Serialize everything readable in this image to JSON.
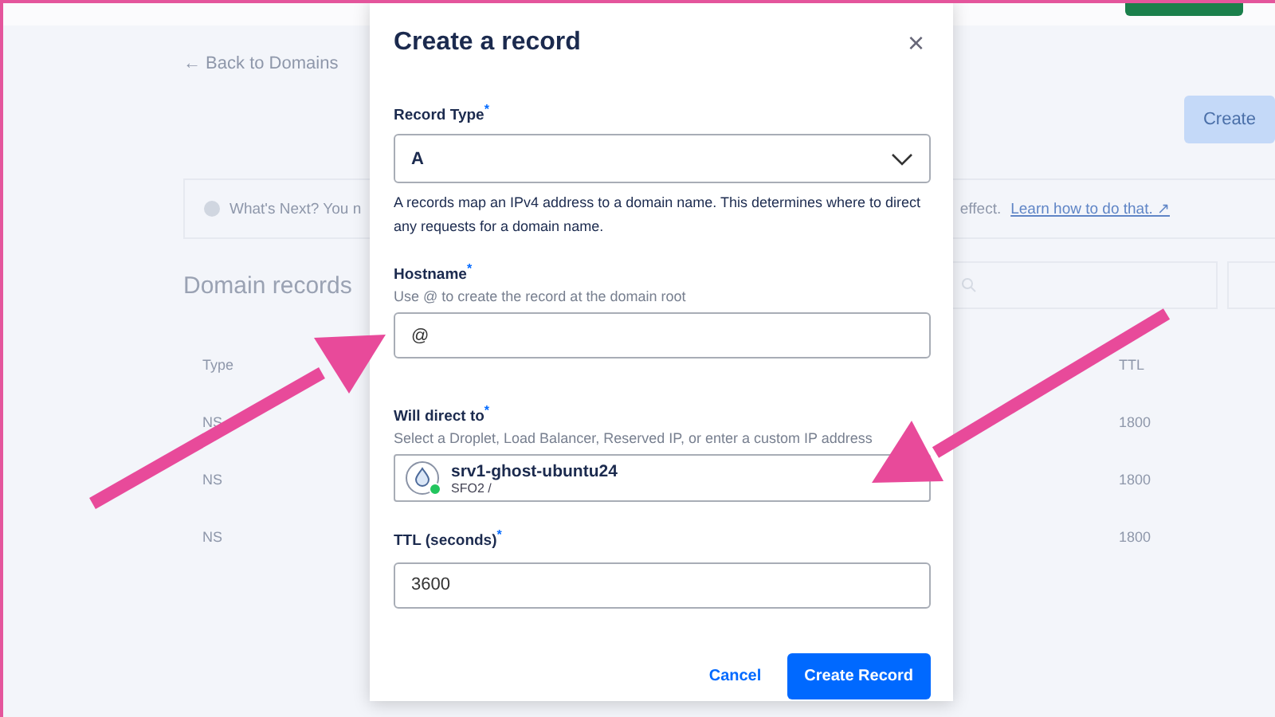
{
  "page": {
    "back_link": "← Back to Domains",
    "create_button": "Create",
    "info": {
      "text": "What's Next? You n",
      "tail": "effect.",
      "link": "Learn how to do that. ↗"
    },
    "section_title": "Domain records",
    "table": {
      "columns": [
        "Type",
        "TTL"
      ],
      "rows": [
        {
          "type": "NS",
          "ttl": "1800"
        },
        {
          "type": "NS",
          "ttl": "1800"
        },
        {
          "type": "NS",
          "ttl": "1800"
        }
      ]
    }
  },
  "dialog": {
    "title": "Create a record",
    "close": "×",
    "record_type": {
      "label": "Record Type$^{*}$",
      "value": "A",
      "help": "A records map an IPv4 address to a domain name. This determines where to direct any requests for a domain name."
    },
    "hostname": {
      "label": "Hostname$^{*}$",
      "hint": "Use @ to create the record at the domain root",
      "value": "@"
    },
    "direct_to": {
      "label": "Will direct to$^{*}$",
      "hint": "Select a Droplet, Load Balancer, Reserved IP, or enter a custom IP address",
      "droplet_name": "srv1-ghost-ubuntu24",
      "droplet_region": "SFO2 /"
    },
    "ttl": {
      "label": "TTL (seconds)$^{*}$",
      "value": "3600"
    },
    "buttons": {
      "cancel": "Cancel",
      "submit": "Create Record"
    }
  }
}
